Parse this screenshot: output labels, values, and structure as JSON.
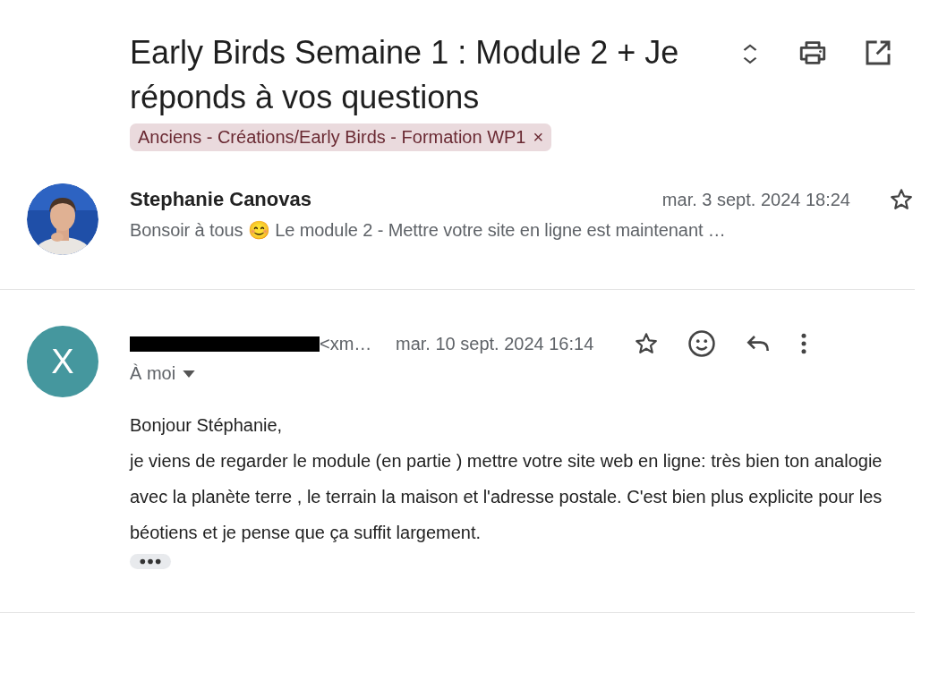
{
  "subject": {
    "title": "Early Birds Semaine 1 : Module 2 + Je réponds à vos questions",
    "label": {
      "text": "Anciens - Créations/Early Birds - Formation WP1",
      "remove": "×"
    }
  },
  "messages": [
    {
      "kind": "collapsed",
      "sender": "Stephanie Canovas",
      "date": "mar. 3 sept. 2024 18:24",
      "starred": false,
      "snippet": "Bonsoir à tous 😊 Le module 2 - Mettre votre site en ligne est maintenant …"
    },
    {
      "kind": "expanded",
      "avatar": {
        "kind": "letter",
        "letter": "X",
        "color": "#45979e"
      },
      "sender_redacted": true,
      "sender_email": "<xm…",
      "date": "mar. 10 sept. 2024 16:14",
      "starred": false,
      "recipient": "À moi",
      "body": [
        "Bonjour Stéphanie,",
        "je viens de regarder le module (en partie ) mettre votre site web en ligne: très bien ton analogie avec la planète terre , le terrain la maison et l'adresse postale. C'est bien plus explicite pour les béotiens et je pense que ça suffit largement."
      ]
    }
  ]
}
